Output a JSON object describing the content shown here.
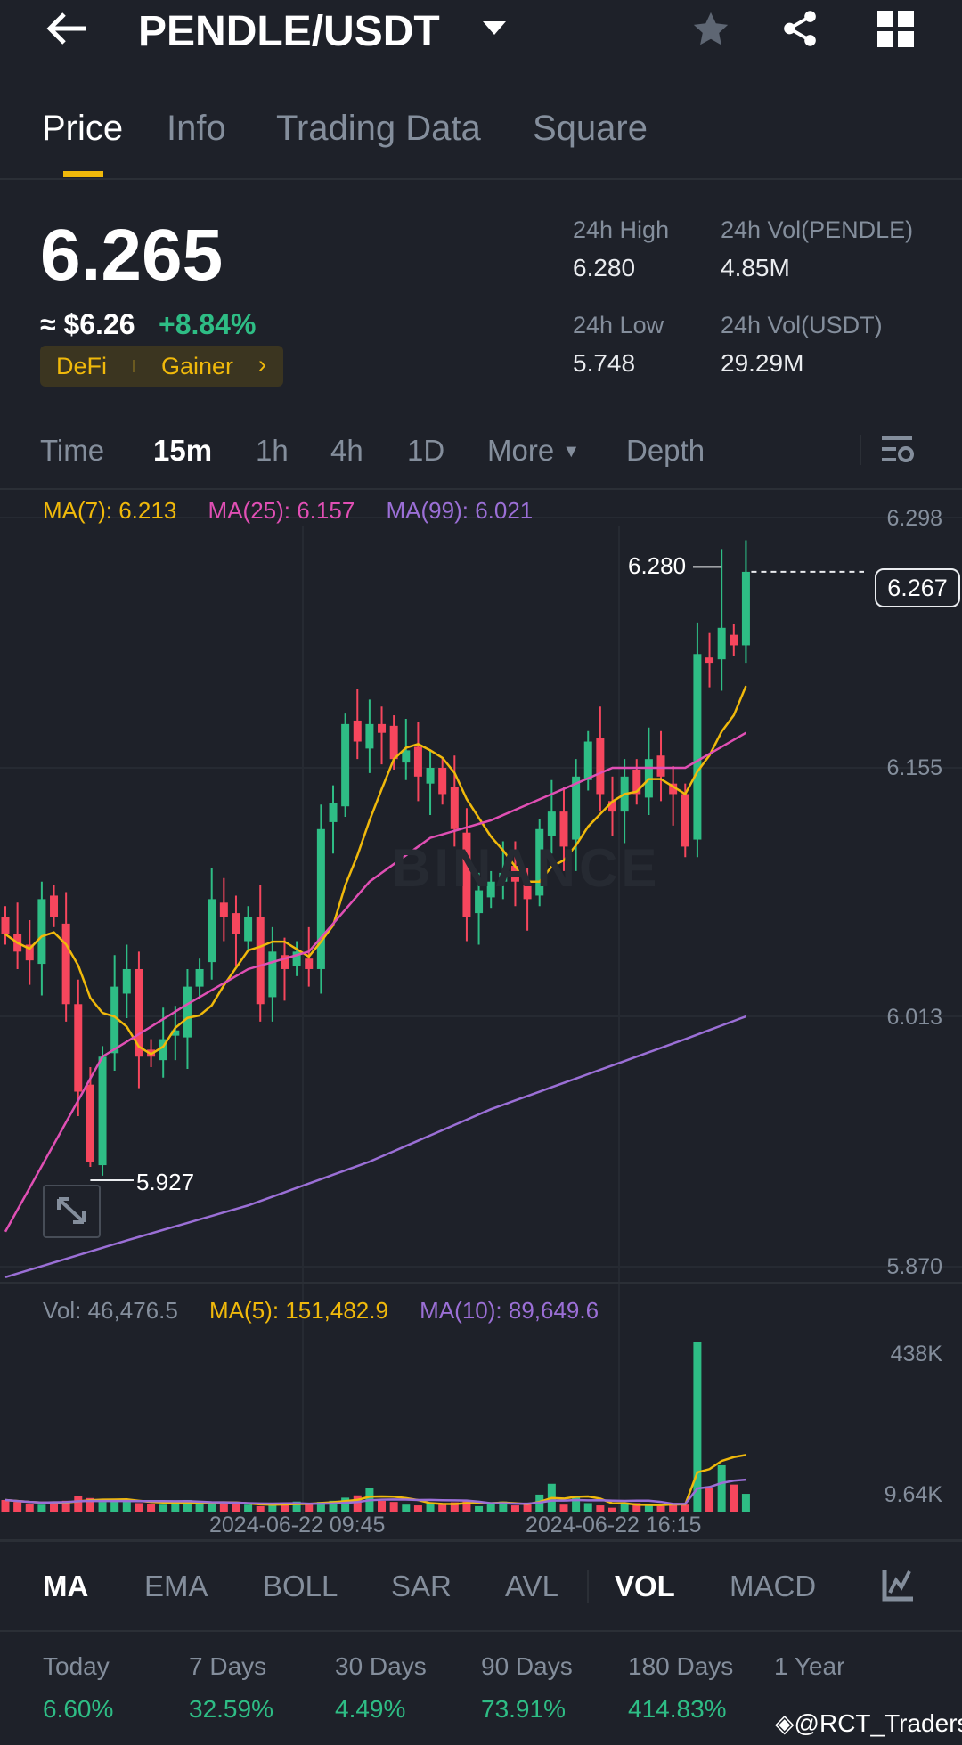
{
  "header": {
    "title": "PENDLE/USDT"
  },
  "tabs": [
    "Price",
    "Info",
    "Trading Data",
    "Square"
  ],
  "price": {
    "last": "6.265",
    "usd": "≈ $6.26",
    "change": "+8.84%",
    "tag1": "DeFi",
    "tag2": "Gainer"
  },
  "stats": {
    "high_label": "24h High",
    "high": "6.280",
    "low_label": "24h Low",
    "low": "5.748",
    "vol_base_label": "24h Vol(PENDLE)",
    "vol_base": "4.85M",
    "vol_quote_label": "24h Vol(USDT)",
    "vol_quote": "29.29M"
  },
  "timeframes": [
    "Time",
    "15m",
    "1h",
    "4h",
    "1D",
    "More",
    "Depth"
  ],
  "ma_legend": {
    "ma7": "MA(7): 6.213",
    "ma25": "MA(25): 6.157",
    "ma99": "MA(99): 6.021"
  },
  "vol_legend": {
    "vol": "Vol: 46,476.5",
    "ma5": "MA(5): 151,482.9",
    "ma10": "MA(10): 89,649.6"
  },
  "colors": {
    "up": "#2ebd85",
    "down": "#f6465d",
    "ma7": "#f0b90b",
    "ma25": "#e04fb4",
    "ma99": "#9b6fd6",
    "accent": "#f0b90b"
  },
  "chart_data": {
    "type": "candlestick",
    "price_axis": [
      "6.298",
      "6.155",
      "6.013",
      "5.870"
    ],
    "ylim": [
      5.87,
      6.298
    ],
    "high_label": "6.280",
    "low_label": "5.927",
    "current_label": "6.267",
    "high_value": 6.28,
    "low_value": 5.927,
    "current_value": 6.267,
    "high_index": 59,
    "low_index": 7,
    "closes": [
      6.06,
      6.05,
      6.045,
      6.08,
      6.07,
      6.02,
      5.97,
      5.93,
      5.99,
      6.03,
      6.04,
      5.99,
      5.99,
      6.0,
      6.005,
      6.03,
      6.04,
      6.08,
      6.07,
      6.06,
      6.07,
      6.02,
      6.05,
      6.04,
      6.05,
      6.04,
      6.12,
      6.135,
      6.18,
      6.17,
      6.18,
      6.175,
      6.16,
      6.165,
      6.15,
      6.155,
      6.14,
      6.12,
      6.07,
      6.085,
      6.09,
      6.095,
      6.09,
      6.08,
      6.12,
      6.13,
      6.11,
      6.15,
      6.17,
      6.14,
      6.13,
      6.15,
      6.14,
      6.16,
      6.15,
      6.14,
      6.11,
      6.22,
      6.215,
      6.235,
      6.225,
      6.267
    ],
    "ma25_points": [
      [
        0,
        5.89
      ],
      [
        8,
        5.99
      ],
      [
        15,
        6.02
      ],
      [
        20,
        6.04
      ],
      [
        25,
        6.05
      ],
      [
        30,
        6.09
      ],
      [
        35,
        6.115
      ],
      [
        40,
        6.125
      ],
      [
        45,
        6.14
      ],
      [
        50,
        6.155
      ],
      [
        56,
        6.155
      ],
      [
        61,
        6.175
      ]
    ],
    "ma99_points": [
      [
        0,
        5.864
      ],
      [
        10,
        5.885
      ],
      [
        20,
        5.905
      ],
      [
        30,
        5.93
      ],
      [
        40,
        5.96
      ],
      [
        50,
        5.985
      ],
      [
        56,
        6.0
      ],
      [
        61,
        6.013
      ]
    ],
    "volume_axis": [
      "438K",
      "9.64K"
    ],
    "volumes": [
      30,
      25,
      20,
      18,
      26,
      28,
      40,
      35,
      25,
      28,
      30,
      22,
      20,
      18,
      22,
      30,
      26,
      22,
      20,
      20,
      18,
      14,
      18,
      22,
      26,
      20,
      25,
      28,
      36,
      42,
      62,
      28,
      25,
      18,
      16,
      22,
      18,
      24,
      30,
      14,
      22,
      26,
      16,
      18,
      44,
      72,
      18,
      40,
      22,
      16,
      10,
      20,
      22,
      18,
      14,
      20,
      18,
      438,
      60,
      120,
      70,
      46
    ],
    "x_labels": [
      "2024-06-22 09:45",
      "2024-06-22 16:15"
    ]
  },
  "indicators": [
    "MA",
    "EMA",
    "BOLL",
    "SAR",
    "AVL",
    "VOL",
    "MACD"
  ],
  "performance": [
    {
      "label": "Today",
      "value": "6.60%"
    },
    {
      "label": "7 Days",
      "value": "32.59%"
    },
    {
      "label": "30 Days",
      "value": "4.49%"
    },
    {
      "label": "90 Days",
      "value": "73.91%"
    },
    {
      "label": "180 Days",
      "value": "414.83%"
    },
    {
      "label": "1 Year",
      "value": ""
    }
  ],
  "watermark": "@RCT_Traders",
  "chart_watermark": "BINANCE"
}
